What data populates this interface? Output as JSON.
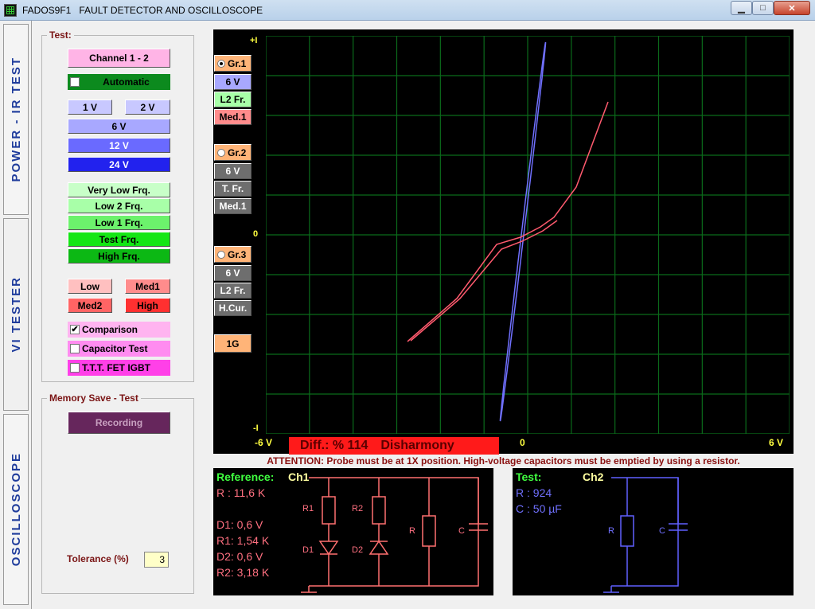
{
  "window": {
    "title": "FADOS9F1   FAULT DETECTOR AND OSCILLOSCOPE",
    "minimize": "▁",
    "maximize": "□",
    "close": "✕"
  },
  "side_tabs": [
    "POWER - IR TEST",
    "VI   TESTER",
    "OSCILLOSCOPE"
  ],
  "test": {
    "group_title": "Test:",
    "channel": "Channel 1 - 2",
    "automatic": "Automatic",
    "voltages": [
      "1 V",
      "2 V",
      "6 V",
      "12 V",
      "24 V"
    ],
    "frequencies": [
      "Very Low Frq.",
      "Low 2 Frq.",
      "Low 1 Frq.",
      "Test Frq.",
      "High Frq."
    ],
    "currents": [
      "Low",
      "Med1",
      "Med2",
      "High"
    ],
    "options": [
      {
        "label": "Comparison",
        "checked": true
      },
      {
        "label": "Capacitor Test",
        "checked": false
      },
      {
        "label": "T.T.T. FET  IGBT",
        "checked": false
      }
    ]
  },
  "memory": {
    "group_title": "Memory Save - Test",
    "recording": "Recording",
    "tolerance_label": "Tolerance (%)",
    "tolerance_value": "3"
  },
  "graph_sel": [
    {
      "radio": "Gr.1",
      "selected": true,
      "volt": "6 V",
      "freq": "L2 Fr.",
      "cur": "Med.1"
    },
    {
      "radio": "Gr.2",
      "selected": false,
      "volt": "6 V",
      "freq": "T. Fr.",
      "cur": "Med.1"
    },
    {
      "radio": "Gr.3",
      "selected": false,
      "volt": "6 V",
      "freq": "L2 Fr.",
      "cur": "H.Cur."
    }
  ],
  "one_g": "1G",
  "plot": {
    "y_top": "+I",
    "y_mid": "0",
    "y_bot": "-I",
    "x_left": "-6 V",
    "x_mid": "0",
    "x_right": "6 V"
  },
  "diff": {
    "label": "Diff.:  % 114",
    "status": "Disharmony"
  },
  "attention": "ATTENTION: Probe must be at 1X position. High-voltage capacitors must be emptied by using a resistor.",
  "reference": {
    "title": "Reference:",
    "channel": "Ch1",
    "r": "R : 11,6 K",
    "d1": "D1: 0,6 V",
    "r1": "R1: 1,54 K",
    "d2": "D2: 0,6 V",
    "r2": "R2: 3,18 K",
    "labels": {
      "r1": "R1",
      "r2": "R2",
      "r": "R",
      "c": "C",
      "d1": "D1",
      "d2": "D2"
    }
  },
  "test_panel": {
    "title": "Test:",
    "channel": "Ch2",
    "r": "R : 924",
    "c": "C : 50 µF",
    "labels": {
      "r": "R",
      "c": "C"
    }
  },
  "colors": {
    "ref_trace": "#ff5a6e",
    "test_trace": "#7070ff",
    "grid": "#0b6b1b",
    "axis_label": "#ffff40"
  }
}
